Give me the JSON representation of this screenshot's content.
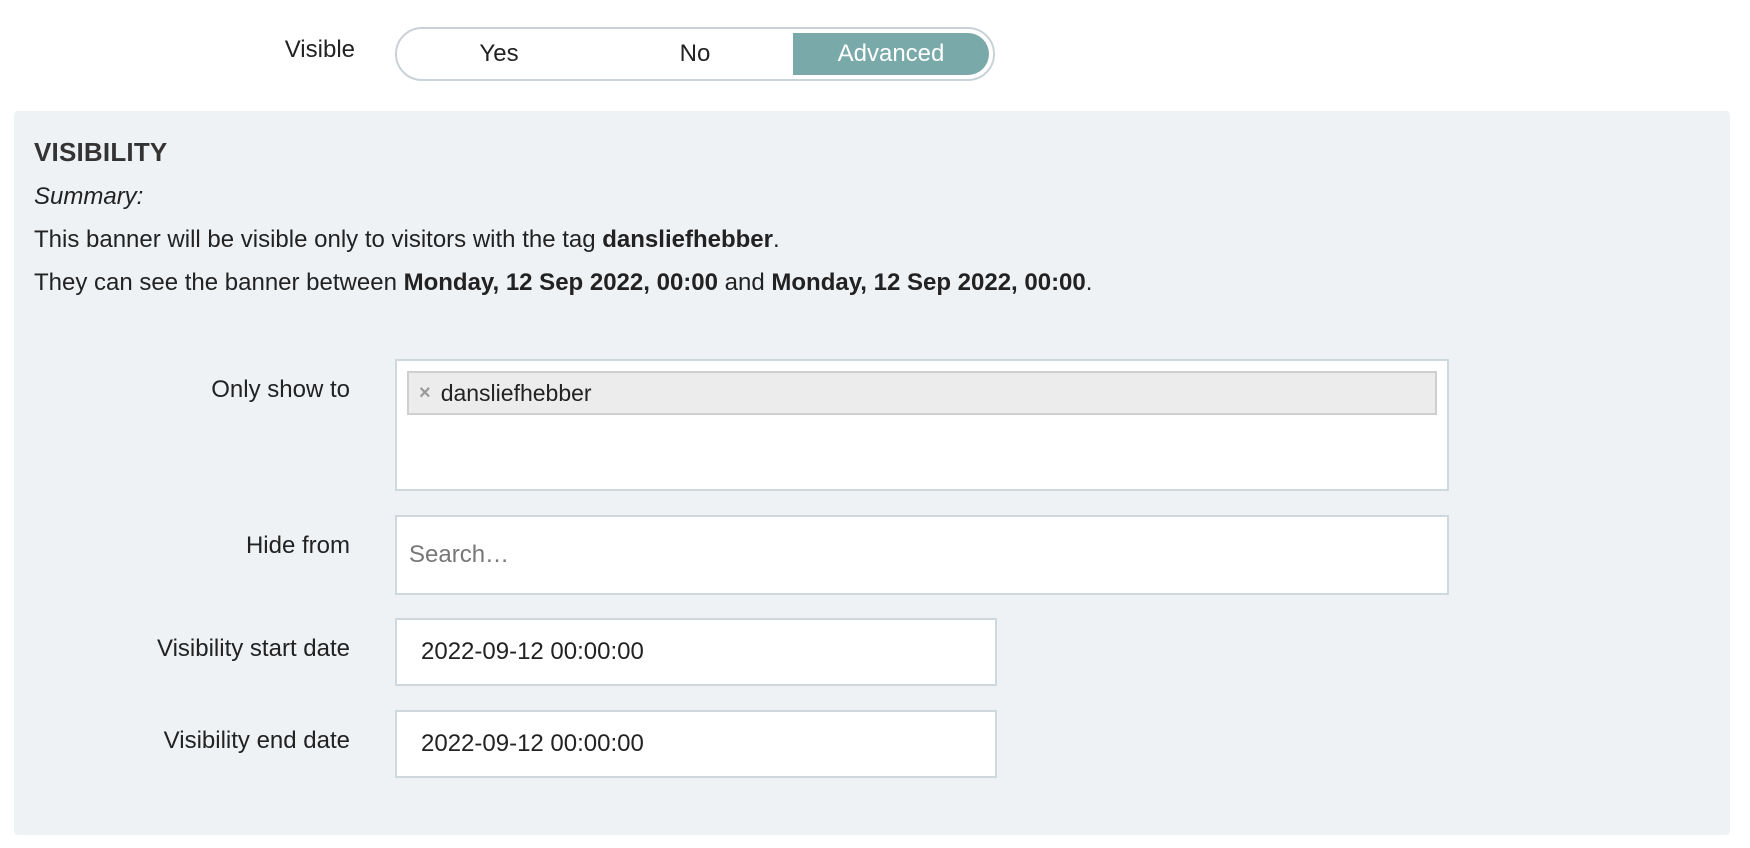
{
  "visible": {
    "label": "Visible",
    "options": [
      "Yes",
      "No",
      "Advanced"
    ],
    "selected": "Advanced",
    "accent_color": "#79aaa9"
  },
  "visibility": {
    "title": "VISIBILITY",
    "summary_label": "Summary:",
    "line1": {
      "prefix": "This banner will be visible only to visitors with the tag ",
      "tag": "dansliefhebber",
      "suffix": "."
    },
    "line2": {
      "prefix": "They can see the banner between ",
      "start": "Monday, 12 Sep 2022, 00:00",
      "middle": " and ",
      "end": "Monday, 12 Sep 2022, 00:00",
      "suffix": "."
    },
    "only_show_to": {
      "label": "Only show to",
      "tags": [
        "dansliefhebber"
      ],
      "remove_glyph": "×"
    },
    "hide_from": {
      "label": "Hide from",
      "placeholder": "Search…",
      "value": ""
    },
    "start_date": {
      "label": "Visibility start date",
      "value": "2022-09-12 00:00:00"
    },
    "end_date": {
      "label": "Visibility end date",
      "value": "2022-09-12 00:00:00"
    }
  }
}
